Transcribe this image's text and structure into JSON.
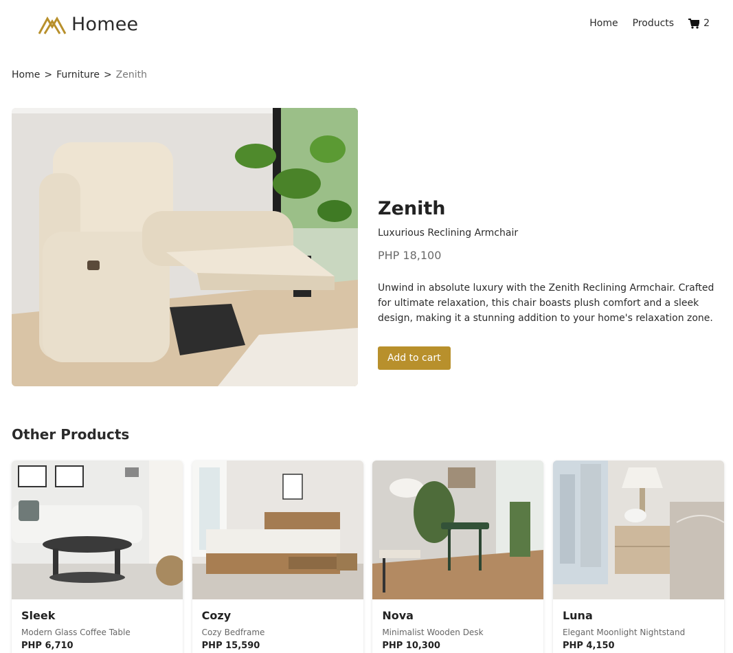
{
  "brand": {
    "name": "Homee",
    "accent": "#b8902c"
  },
  "nav": {
    "home": "Home",
    "products": "Products",
    "cart_count": "2",
    "cart_icon": "cart-icon"
  },
  "breadcrumb": [
    "Home",
    "Furniture",
    "Zenith"
  ],
  "breadcrumb_sep": ">",
  "product": {
    "name": "Zenith",
    "subtitle": "Luxurious Reclining Armchair",
    "price": "PHP 18,100",
    "description": "Unwind in absolute luxury with the Zenith Reclining Armchair. Crafted for ultimate relaxation, this chair boasts plush comfort and a sleek design, making it a stunning addition to your home's relaxation zone.",
    "add_to_cart": "Add to cart"
  },
  "other": {
    "title": "Other Products",
    "items": [
      {
        "name": "Sleek",
        "subtitle": "Modern Glass Coffee Table",
        "price": "PHP 6,710"
      },
      {
        "name": "Cozy",
        "subtitle": "Cozy Bedframe",
        "price": "PHP 15,590"
      },
      {
        "name": "Nova",
        "subtitle": "Minimalist Wooden Desk",
        "price": "PHP 10,300"
      },
      {
        "name": "Luna",
        "subtitle": "Elegant Moonlight Nightstand",
        "price": "PHP 4,150"
      }
    ]
  }
}
